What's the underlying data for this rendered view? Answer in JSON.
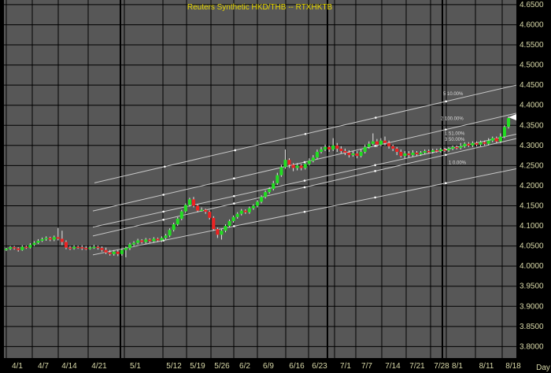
{
  "chart_data": {
    "type": "candlestick",
    "title": "Reuters  Synthetic  HKD/THB  --  RTXHKTB",
    "x_unit_label": "Day",
    "colors": {
      "background": "#575757",
      "frame": "#000000",
      "grid": "#000000",
      "title": "#e8d800",
      "axis_text": "#d8d8a8",
      "up": "#22dd22",
      "down": "#ee2222",
      "channel": "#c8c8c8"
    },
    "y_axis": {
      "range": [
        3.7715,
        4.6615
      ],
      "ticks": [
        "4.6500",
        "4.6000",
        "4.5500",
        "4.5000",
        "4.4500",
        "4.4000",
        "4.3500",
        "4.3000",
        "4.2500",
        "4.2000",
        "4.1500",
        "4.1000",
        "4.0500",
        "4.0000",
        "3.9500",
        "3.9000",
        "3.8500",
        "3.8000"
      ],
      "last_value": "4.3700"
    },
    "x_axis": {
      "date_labels": [
        "4/1",
        "4/7",
        "4/14",
        "4/21",
        "5/1",
        "5/12",
        "5/19",
        "5/26",
        "6/2",
        "6/9",
        "6/16",
        "6/23",
        "7/1",
        "7/7",
        "7/14",
        "7/21",
        "7/28",
        "8/1",
        "8/11",
        "8/18"
      ],
      "major_boundaries": [
        4,
        153,
        416,
        562
      ]
    },
    "channel_labels": [
      "5 10.00%",
      "2 100.00%",
      "1 51.00%",
      "3 50.00%",
      "1 0.00%"
    ],
    "candles": [
      [
        4.04,
        4.043,
        4.045,
        4.038
      ],
      [
        4.043,
        4.047,
        4.05,
        4.04
      ],
      [
        4.047,
        4.044,
        4.05,
        4.041
      ],
      [
        4.044,
        4.04,
        4.047,
        4.036
      ],
      [
        4.04,
        4.048,
        4.052,
        4.038
      ],
      [
        4.048,
        4.046,
        4.051,
        4.043
      ],
      [
        4.046,
        4.053,
        4.057,
        4.044
      ],
      [
        4.053,
        4.058,
        4.062,
        4.05
      ],
      [
        4.058,
        4.063,
        4.067,
        4.055
      ],
      [
        4.063,
        4.067,
        4.071,
        4.06
      ],
      [
        4.067,
        4.07,
        4.074,
        4.063
      ],
      [
        4.07,
        4.066,
        4.073,
        4.062
      ],
      [
        4.066,
        4.072,
        4.076,
        4.062
      ],
      [
        4.072,
        4.068,
        4.095,
        4.064
      ],
      [
        4.068,
        4.06,
        4.088,
        4.052
      ],
      [
        4.06,
        4.046,
        4.064,
        4.042
      ],
      [
        4.046,
        4.044,
        4.05,
        4.04
      ],
      [
        4.044,
        4.048,
        4.052,
        4.041
      ],
      [
        4.048,
        4.047,
        4.051,
        4.043
      ],
      [
        4.047,
        4.045,
        4.052,
        4.04
      ],
      [
        4.045,
        4.044,
        4.05,
        4.04
      ],
      [
        4.044,
        4.046,
        4.05,
        4.041
      ],
      [
        4.046,
        4.048,
        4.053,
        4.043
      ],
      [
        4.048,
        4.045,
        4.051,
        4.041
      ],
      [
        4.045,
        4.04,
        4.049,
        4.036
      ],
      [
        4.04,
        4.034,
        4.046,
        4.03
      ],
      [
        4.034,
        4.03,
        4.04,
        4.026
      ],
      [
        4.03,
        4.036,
        4.04,
        4.026
      ],
      [
        4.036,
        4.03,
        4.04,
        4.025
      ],
      [
        4.03,
        4.04,
        4.044,
        4.026
      ],
      [
        4.04,
        4.045,
        4.049,
        4.022
      ],
      [
        4.045,
        4.054,
        4.058,
        4.04
      ],
      [
        4.054,
        4.058,
        4.062,
        4.05
      ],
      [
        4.058,
        4.064,
        4.068,
        4.054
      ],
      [
        4.064,
        4.06,
        4.067,
        4.056
      ],
      [
        4.06,
        4.066,
        4.07,
        4.056
      ],
      [
        4.066,
        4.062,
        4.069,
        4.058
      ],
      [
        4.062,
        4.068,
        4.072,
        4.058
      ],
      [
        4.068,
        4.064,
        4.071,
        4.06
      ],
      [
        4.064,
        4.07,
        4.074,
        4.06
      ],
      [
        4.07,
        4.076,
        4.08,
        4.066
      ],
      [
        4.076,
        4.09,
        4.094,
        4.072
      ],
      [
        4.09,
        4.104,
        4.108,
        4.086
      ],
      [
        4.104,
        4.118,
        4.122,
        4.1
      ],
      [
        4.118,
        4.136,
        4.14,
        4.114
      ],
      [
        4.136,
        4.152,
        4.156,
        4.132
      ],
      [
        4.152,
        4.166,
        4.17,
        4.148
      ],
      [
        4.166,
        4.15,
        4.172,
        4.146
      ],
      [
        4.15,
        4.138,
        4.154,
        4.134
      ],
      [
        4.138,
        4.14,
        4.146,
        4.136
      ],
      [
        4.14,
        4.135,
        4.143,
        4.13
      ],
      [
        4.135,
        4.12,
        4.138,
        4.116
      ],
      [
        4.12,
        4.092,
        4.124,
        4.088
      ],
      [
        4.092,
        4.078,
        4.096,
        4.07
      ],
      [
        4.078,
        4.088,
        4.092,
        4.066
      ],
      [
        4.088,
        4.1,
        4.104,
        4.084
      ],
      [
        4.1,
        4.112,
        4.116,
        4.096
      ],
      [
        4.112,
        4.122,
        4.126,
        4.108
      ],
      [
        4.122,
        4.13,
        4.134,
        4.118
      ],
      [
        4.13,
        4.138,
        4.142,
        4.126
      ],
      [
        4.138,
        4.134,
        4.141,
        4.13
      ],
      [
        4.134,
        4.144,
        4.148,
        4.13
      ],
      [
        4.144,
        4.15,
        4.154,
        4.14
      ],
      [
        4.15,
        4.16,
        4.164,
        4.146
      ],
      [
        4.16,
        4.172,
        4.176,
        4.156
      ],
      [
        4.172,
        4.184,
        4.188,
        4.168
      ],
      [
        4.184,
        4.192,
        4.196,
        4.18
      ],
      [
        4.192,
        4.206,
        4.212,
        4.188
      ],
      [
        4.206,
        4.226,
        4.232,
        4.202
      ],
      [
        4.226,
        4.246,
        4.252,
        4.222
      ],
      [
        4.246,
        4.264,
        4.29,
        4.242
      ],
      [
        4.264,
        4.252,
        4.268,
        4.244
      ],
      [
        4.252,
        4.244,
        4.256,
        4.236
      ],
      [
        4.244,
        4.25,
        4.256,
        4.238
      ],
      [
        4.25,
        4.244,
        4.254,
        4.238
      ],
      [
        4.244,
        4.254,
        4.26,
        4.24
      ],
      [
        4.254,
        4.262,
        4.268,
        4.25
      ],
      [
        4.262,
        4.27,
        4.276,
        4.258
      ],
      [
        4.27,
        4.284,
        4.29,
        4.266
      ],
      [
        4.284,
        4.29,
        4.296,
        4.28
      ],
      [
        4.29,
        4.296,
        4.302,
        4.286
      ],
      [
        4.296,
        4.29,
        4.3,
        4.284
      ],
      [
        4.29,
        4.3,
        4.318,
        4.286
      ],
      [
        4.3,
        4.292,
        4.306,
        4.284
      ],
      [
        4.292,
        4.286,
        4.298,
        4.28
      ],
      [
        4.286,
        4.282,
        4.292,
        4.276
      ],
      [
        4.282,
        4.276,
        4.288,
        4.27
      ],
      [
        4.276,
        4.28,
        4.286,
        4.272
      ],
      [
        4.28,
        4.274,
        4.286,
        4.268
      ],
      [
        4.274,
        4.284,
        4.29,
        4.27
      ],
      [
        4.284,
        4.296,
        4.302,
        4.28
      ],
      [
        4.296,
        4.304,
        4.31,
        4.292
      ],
      [
        4.304,
        4.31,
        4.33,
        4.3
      ],
      [
        4.31,
        4.302,
        4.316,
        4.296
      ],
      [
        4.302,
        4.312,
        4.318,
        4.298
      ],
      [
        4.312,
        4.306,
        4.322,
        4.3
      ],
      [
        4.306,
        4.298,
        4.312,
        4.292
      ],
      [
        4.298,
        4.292,
        4.302,
        4.286
      ],
      [
        4.292,
        4.284,
        4.296,
        4.276
      ],
      [
        4.284,
        4.274,
        4.29,
        4.27
      ],
      [
        4.274,
        4.28,
        4.286,
        4.268
      ],
      [
        4.28,
        4.276,
        4.286,
        4.27
      ],
      [
        4.276,
        4.282,
        4.288,
        4.272
      ],
      [
        4.282,
        4.278,
        4.286,
        4.274
      ],
      [
        4.278,
        4.282,
        4.286,
        4.274
      ],
      [
        4.282,
        4.286,
        4.29,
        4.278
      ],
      [
        4.286,
        4.284,
        4.29,
        4.28
      ],
      [
        4.284,
        4.288,
        4.292,
        4.28
      ],
      [
        4.288,
        4.286,
        4.292,
        4.282
      ],
      [
        4.286,
        4.29,
        4.294,
        4.282
      ],
      [
        4.29,
        4.288,
        4.294,
        4.284
      ],
      [
        4.288,
        4.292,
        4.296,
        4.284
      ],
      [
        4.292,
        4.296,
        4.3,
        4.288
      ],
      [
        4.296,
        4.294,
        4.3,
        4.29
      ],
      [
        4.294,
        4.298,
        4.306,
        4.29
      ],
      [
        4.298,
        4.304,
        4.308,
        4.294
      ],
      [
        4.304,
        4.3,
        4.308,
        4.296
      ],
      [
        4.3,
        4.306,
        4.31,
        4.296
      ],
      [
        4.306,
        4.302,
        4.31,
        4.298
      ],
      [
        4.302,
        4.308,
        4.312,
        4.298
      ],
      [
        4.308,
        4.304,
        4.312,
        4.3
      ],
      [
        4.304,
        4.312,
        4.318,
        4.3
      ],
      [
        4.312,
        4.318,
        4.322,
        4.308
      ],
      [
        4.318,
        4.31,
        4.322,
        4.306
      ],
      [
        4.31,
        4.322,
        4.33,
        4.306
      ],
      [
        4.322,
        4.346,
        4.35,
        4.318
      ],
      [
        4.346,
        4.368,
        4.372,
        4.342
      ]
    ]
  }
}
